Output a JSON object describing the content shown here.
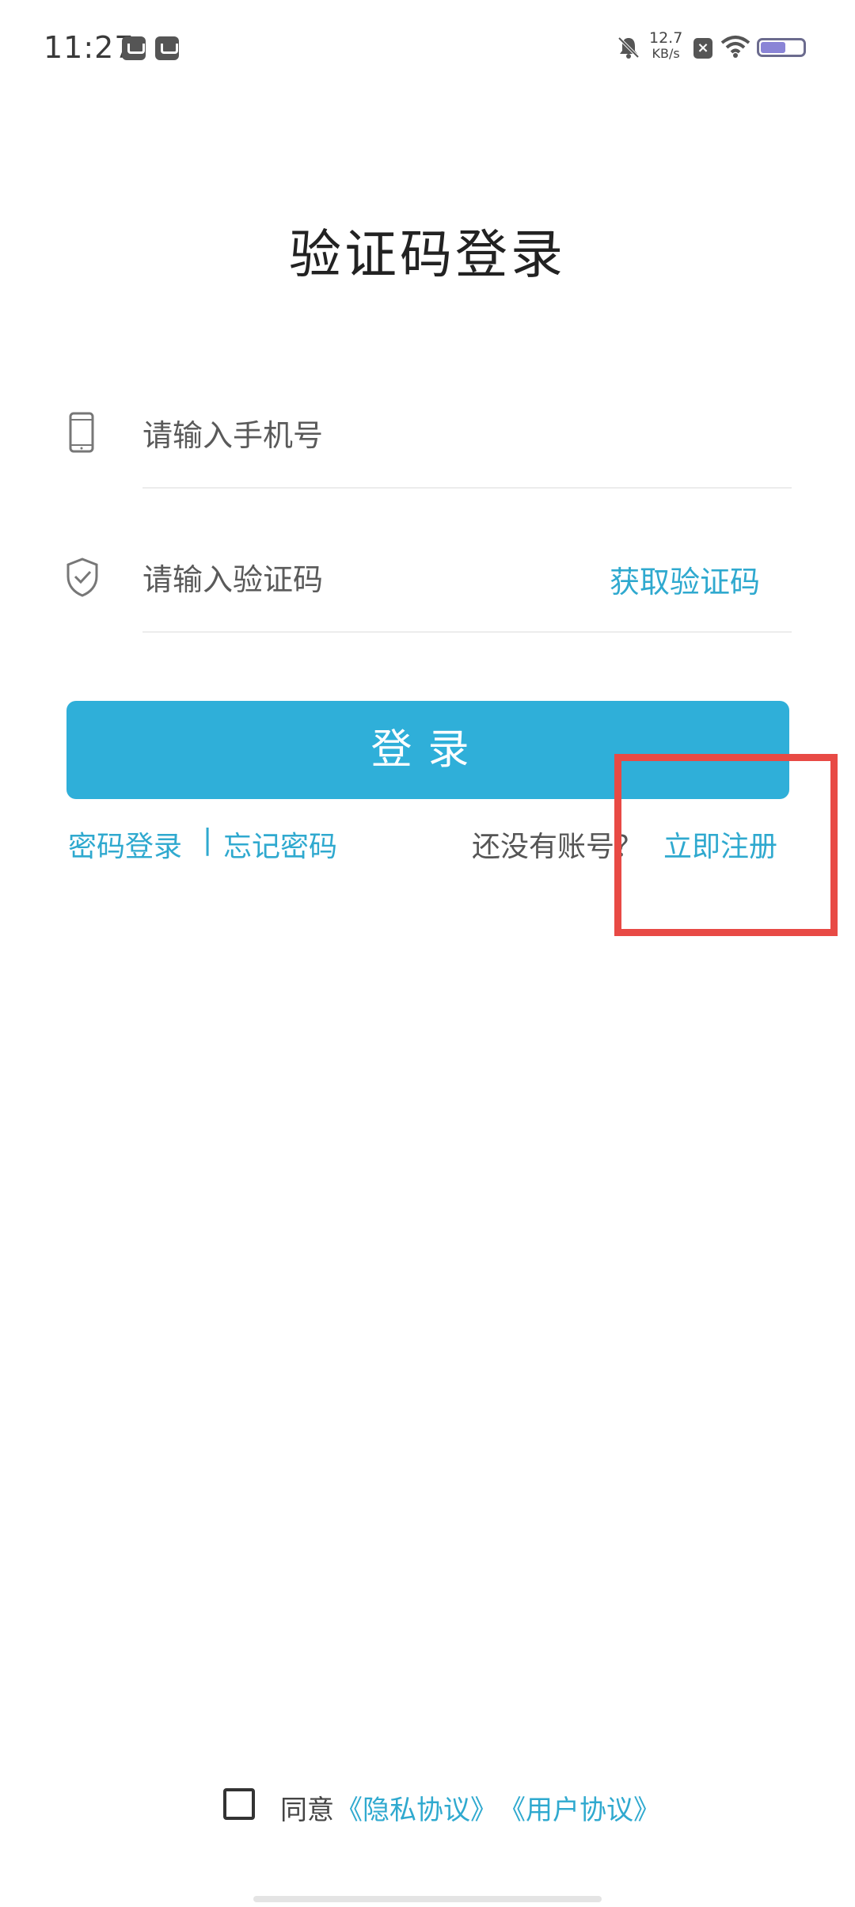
{
  "status_bar": {
    "time": "11:27",
    "net_speed_value": "12.7",
    "net_speed_unit": "KB/s",
    "sim_icon_glyph": "×",
    "battery_level": 0.6,
    "icons": [
      "mail-notification-icon",
      "archive-notification-icon",
      "bell-muted-icon",
      "sim-x-icon",
      "wifi-icon",
      "battery-icon"
    ]
  },
  "page": {
    "title": "验证码登录"
  },
  "phone_field": {
    "placeholder": "请输入手机号",
    "value": "",
    "icon": "phone-icon"
  },
  "code_field": {
    "placeholder": "请输入验证码",
    "value": "",
    "icon": "shield-check-icon",
    "get_code_label": "获取验证码"
  },
  "login_button": {
    "label": "登录"
  },
  "links": {
    "password_login": "密码登录",
    "separator": "|",
    "forgot_password": "忘记密码",
    "no_account": "还没有账号？",
    "register": "立即注册"
  },
  "agreement": {
    "agree_label": "同意",
    "privacy": "《隐私协议》",
    "user_agreement": "《用户协议》",
    "checked": false
  },
  "colors": {
    "accent": "#2fafd9",
    "link": "#2fa9cf",
    "highlight_box": "#e84a45"
  }
}
